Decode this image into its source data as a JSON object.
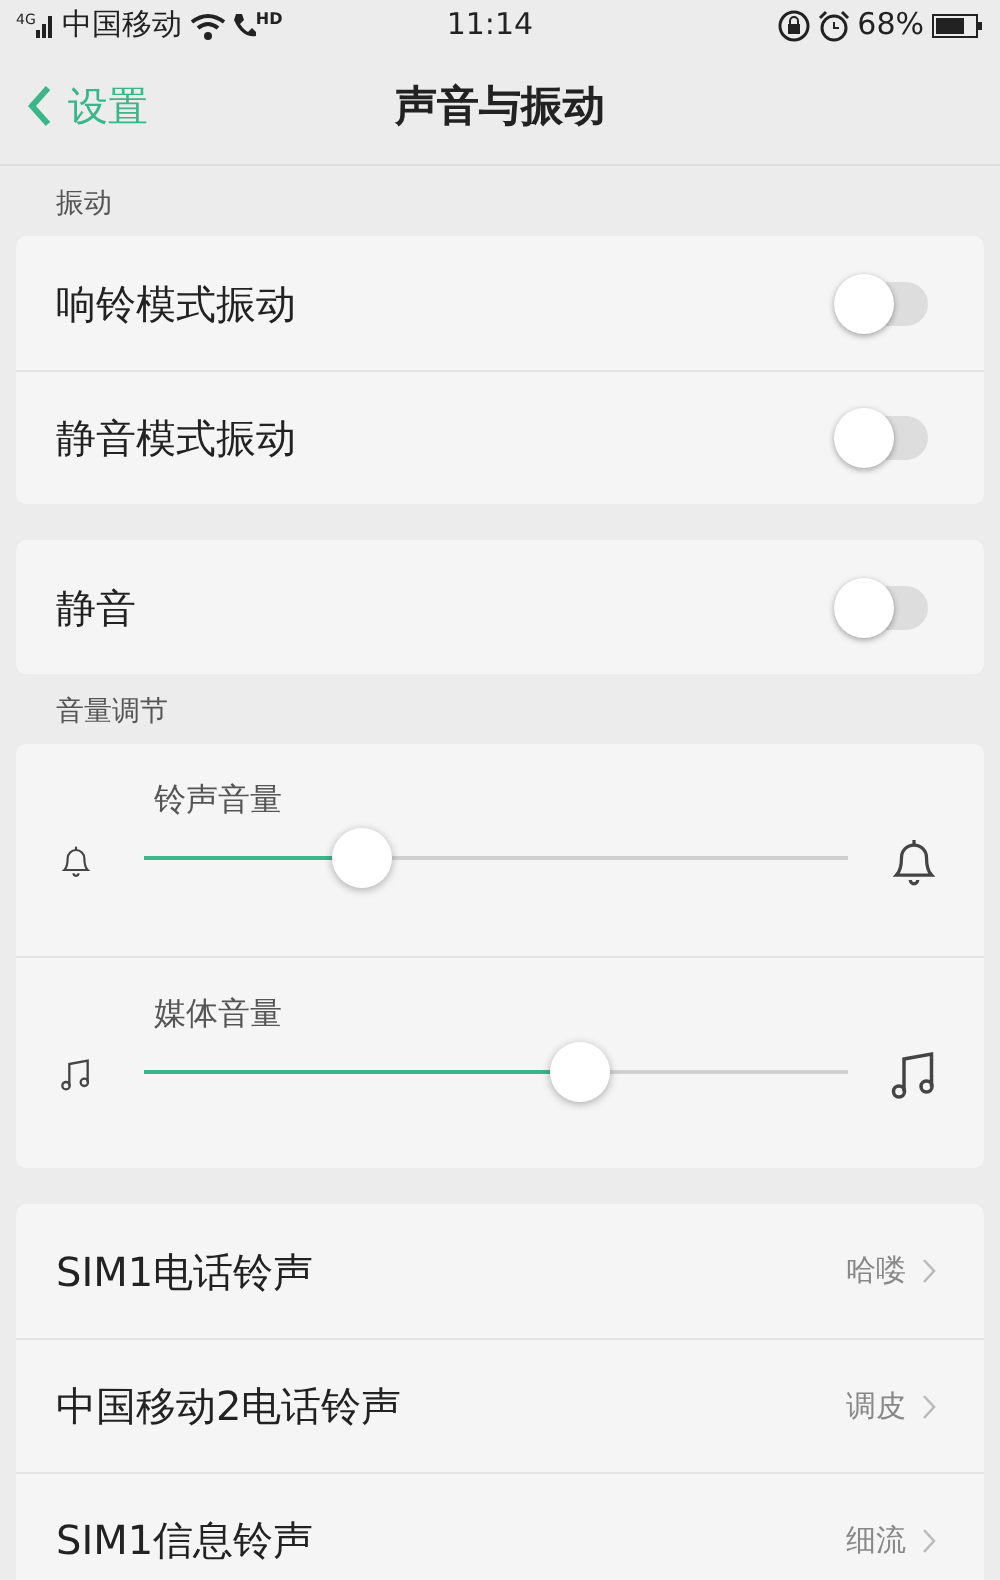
{
  "status_bar": {
    "network": "4G",
    "carrier": "中国移动",
    "call_label": "HD",
    "time": "11:14",
    "battery": "68%"
  },
  "header": {
    "back_label": "设置",
    "title": "声音与振动"
  },
  "sections": [
    {
      "label": "振动",
      "cards": [
        [
          {
            "kind": "toggle",
            "label": "响铃模式振动",
            "on": false
          },
          {
            "kind": "toggle",
            "label": "静音模式振动",
            "on": false
          }
        ],
        [
          {
            "kind": "toggle",
            "label": "静音",
            "on": false
          }
        ]
      ]
    },
    {
      "label": "音量调节",
      "cards": [
        [
          {
            "kind": "slider",
            "label": "铃声音量",
            "level": 0.31
          },
          {
            "kind": "slider",
            "label": "媒体音量",
            "level": 0.62
          }
        ],
        [
          {
            "kind": "link",
            "label": "SIM1电话铃声",
            "value": "哈喽"
          },
          {
            "kind": "link",
            "label": "中国移动2电话铃声",
            "value": "调皮"
          },
          {
            "kind": "link",
            "label": "SIM1信息铃声",
            "value": "细流"
          }
        ]
      ]
    }
  ]
}
